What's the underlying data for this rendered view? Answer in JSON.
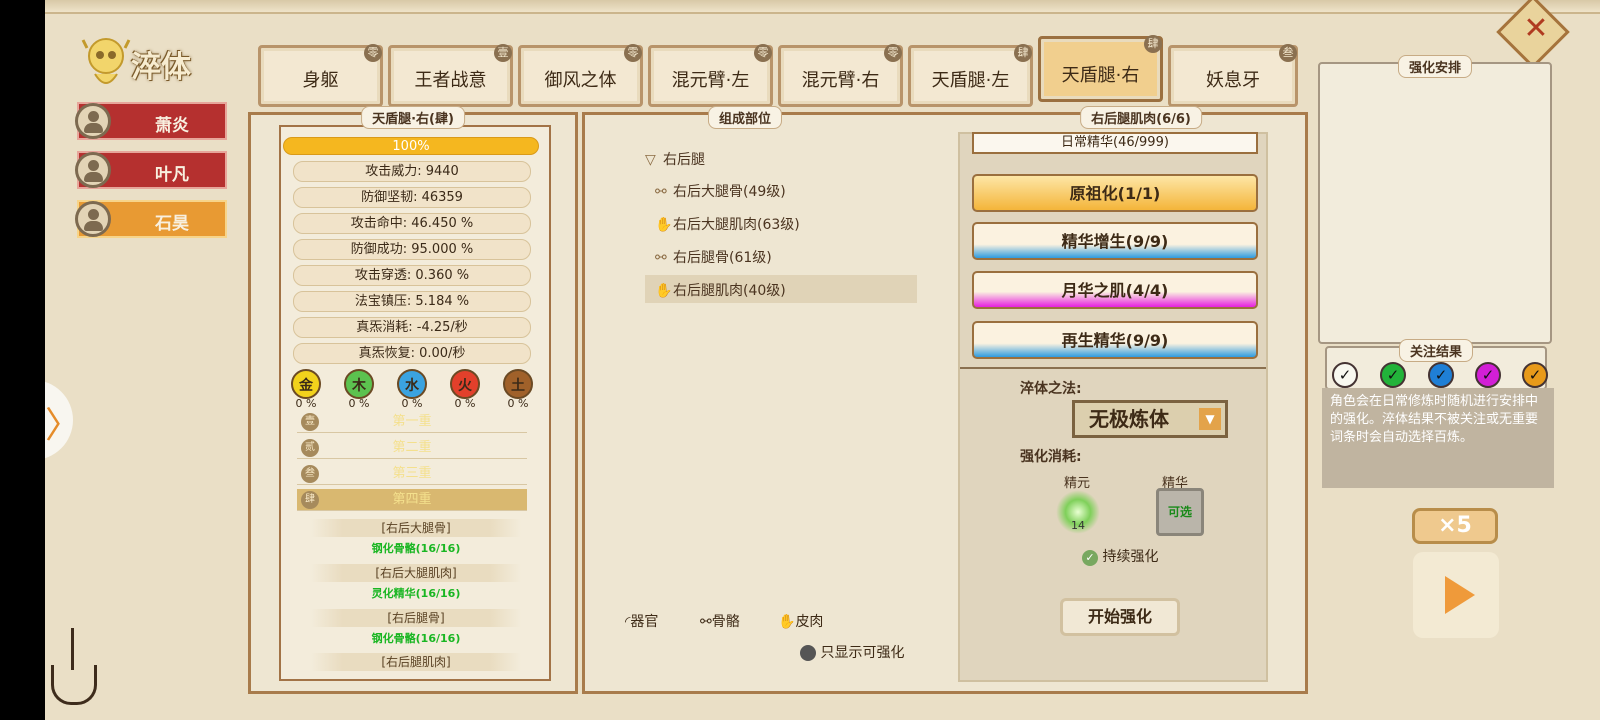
{
  "title": "淬体",
  "characters": [
    {
      "name": "萧炎",
      "active": false
    },
    {
      "name": "叶凡",
      "active": false
    },
    {
      "name": "石昊",
      "active": true
    }
  ],
  "tabs": [
    {
      "label": "身躯",
      "badge": "零"
    },
    {
      "label": "王者战意",
      "badge": "壹"
    },
    {
      "label": "御风之体",
      "badge": "零"
    },
    {
      "label": "混元臂·左",
      "badge": "零"
    },
    {
      "label": "混元臂·右",
      "badge": "零"
    },
    {
      "label": "天盾腿·左",
      "badge": "肆"
    },
    {
      "label": "天盾腿·右",
      "badge": "肆",
      "active": true
    },
    {
      "label": "妖息牙",
      "badge": "叁"
    }
  ],
  "stats_panel": {
    "title": "天盾腿·右(肆)",
    "progress": "100%",
    "stats": [
      "攻击威力: 9440",
      "防御坚韧: 46359",
      "攻击命中: 46.450 %",
      "防御成功: 95.000 %",
      "攻击穿透: 0.360 %",
      "法宝镇压: 5.184 %",
      "真炁消耗: -4.25/秒",
      "真炁恢复: 0.00/秒"
    ],
    "elements": [
      {
        "name": "金",
        "pct": "0 %",
        "color": "#f2d21c"
      },
      {
        "name": "木",
        "pct": "0 %",
        "color": "#5cc24f"
      },
      {
        "name": "水",
        "pct": "0 %",
        "color": "#3ba3e0"
      },
      {
        "name": "火",
        "pct": "0 %",
        "color": "#e2402b"
      },
      {
        "name": "土",
        "pct": "0 %",
        "color": "#a0612a"
      }
    ],
    "layers": [
      {
        "num": "壹",
        "label": "第一重"
      },
      {
        "num": "贰",
        "label": "第二重"
      },
      {
        "num": "叁",
        "label": "第三重"
      },
      {
        "num": "肆",
        "label": "第四重",
        "active": true
      }
    ],
    "parts": [
      {
        "label": "[右后大腿骨]",
        "value": "钢化骨骼(16/16)"
      },
      {
        "label": "[右后大腿肌肉]",
        "value": "灵化精华(16/16)"
      },
      {
        "label": "[右后腿骨]",
        "value": "钢化骨骼(16/16)"
      },
      {
        "label": "[右后腿肌肉]",
        "value": ""
      }
    ]
  },
  "composition": {
    "title": "组成部位",
    "root": "右后腿",
    "items": [
      {
        "label": "右后大腿骨(49级)",
        "icon": "bone"
      },
      {
        "label": "右后大腿肌肉(63级)",
        "icon": "flesh"
      },
      {
        "label": "右后腿骨(61级)",
        "icon": "bone"
      },
      {
        "label": "右后腿肌肉(40级)",
        "icon": "flesh",
        "selected": true
      }
    ],
    "legend": [
      "器官",
      "骨骼",
      "皮肉"
    ],
    "toggle_label": "只显示可强化"
  },
  "detail": {
    "title": "右后腿肌肉(6/6)",
    "top_partial": "日常精华(46/999)",
    "options": [
      {
        "label": "原祖化(1/1)",
        "style": "gold"
      },
      {
        "label": "精华增生(9/9)",
        "style": "blue"
      },
      {
        "label": "月华之肌(4/4)",
        "style": "pink"
      },
      {
        "label": "再生精华(9/9)",
        "style": "blue"
      }
    ],
    "method_label": "淬体之法:",
    "method_value": "无极炼体",
    "cost_label": "强化消耗:",
    "costs": [
      {
        "name": "精元",
        "value": "14"
      },
      {
        "name": "精华",
        "value": "可选"
      }
    ],
    "continuous_label": "持续强化",
    "start_button": "开始强化"
  },
  "side": {
    "arrange_title": "强化安排",
    "focus_title": "关注结果",
    "checks": [
      {
        "color": "#ffffff"
      },
      {
        "color": "#22b33a"
      },
      {
        "color": "#1f7fd6"
      },
      {
        "color": "#d21fd6"
      },
      {
        "color": "#e89a1a"
      }
    ],
    "note": "角色会在日常修炼时随机进行安排中的强化。淬体结果不被关注或无重要词条时会自动选择百炼。",
    "multiplier": "×5"
  }
}
